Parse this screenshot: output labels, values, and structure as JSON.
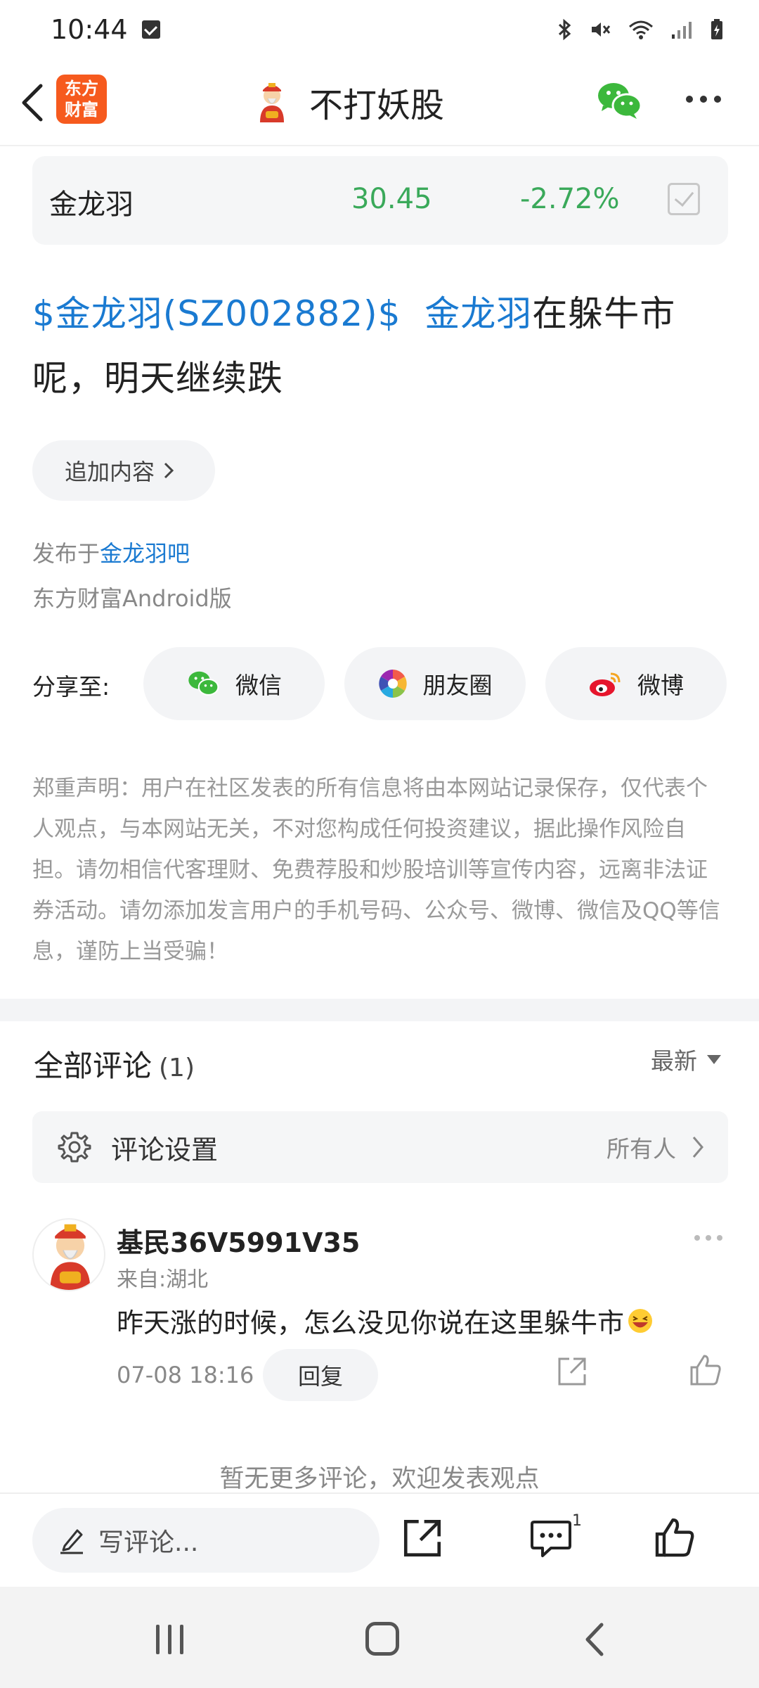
{
  "status_bar": {
    "time": "10:44"
  },
  "nav": {
    "brand_line1": "东方",
    "brand_line2": "财富",
    "title": "不打妖股"
  },
  "stock": {
    "name": "金龙羽",
    "price": "30.45",
    "change": "-2.72%"
  },
  "post": {
    "tag_link": "$金龙羽(SZ002882)$",
    "name_link": "金龙羽",
    "text": "在躲牛市呢，明天继续跌"
  },
  "append_button": "追加内容",
  "publish": {
    "prefix": "发布于",
    "forum": "金龙羽吧",
    "client": "东方财富Android版"
  },
  "share": {
    "label": "分享至:",
    "wechat": "微信",
    "moments": "朋友圈",
    "weibo": "微博"
  },
  "disclaimer": "郑重声明：用户在社区发表的所有信息将由本网站记录保存，仅代表个人观点，与本网站无关，不对您构成任何投资建议，据此操作风险自担。请勿相信代客理财、免费荐股和炒股培训等宣传内容，远离非法证券活动。请勿添加发言用户的手机号码、公众号、微博、微信及QQ等信息，谨防上当受骗！",
  "comments": {
    "title": "全部评论",
    "count": "(1)",
    "sort": "最新",
    "settings_label": "评论设置",
    "settings_value": "所有人",
    "items": [
      {
        "user": "基民36V5991V35",
        "location": "来自:湖北",
        "text": "昨天涨的时候，怎么没见你说在这里躲牛市",
        "time": "07-08 18:16",
        "reply": "回复"
      }
    ],
    "no_more": "暂无更多评论，欢迎发表观点"
  },
  "bottom_bar": {
    "input_placeholder": "写评论...",
    "comment_badge": "1"
  },
  "colors": {
    "link": "#1a7ad1",
    "stock_down": "#3aa95a",
    "brand": "#f65a1e",
    "wechat": "#3cb83c"
  }
}
